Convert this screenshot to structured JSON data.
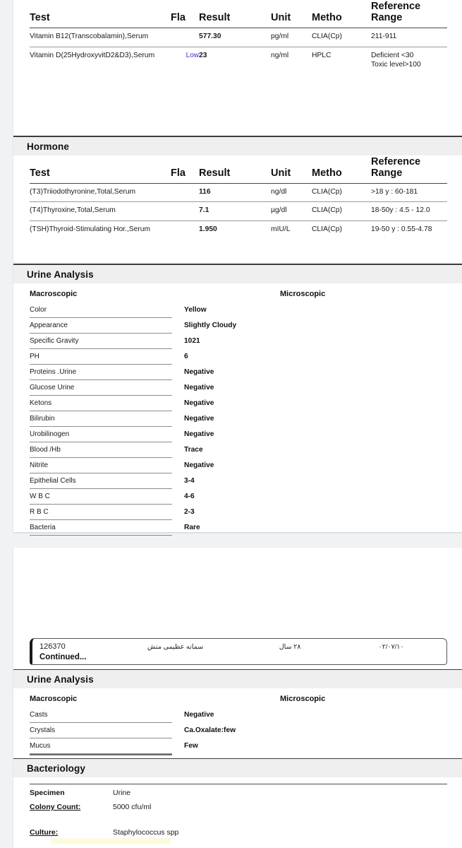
{
  "report": {
    "columns": {
      "test": "Test",
      "flag": "Fla",
      "result": "Result",
      "unit": "Unit",
      "method": "Metho",
      "reference": "Reference Range"
    },
    "vitamin_rows": [
      {
        "test": "Vitamin B12(Transcobalamin),Serum",
        "flag": "",
        "result": "577.30",
        "unit": "pg/ml",
        "method": "CLIA(Cp)",
        "reference": "211-911"
      },
      {
        "test": "Vitamin D(25HydroxyvitD2&D3),Serum",
        "flag": "Low",
        "result": "23",
        "unit": "ng/ml",
        "method": "HPLC",
        "reference": "Deficient <30\nToxic level>100"
      }
    ],
    "hormone": {
      "section_title": "Hormone",
      "rows": [
        {
          "test": "(T3)Triiodothyronine,Total,Serum",
          "flag": "",
          "result": "116",
          "unit": "ng/dl",
          "method": "CLIA(Cp)",
          "reference": ">18 y : 60-181"
        },
        {
          "test": "(T4)Thyroxine,Total,Serum",
          "flag": "",
          "result": "7.1",
          "unit": "µg/dl",
          "method": "CLIA(Cp)",
          "reference": "18-50y : 4.5 - 12.0"
        },
        {
          "test": "(TSH)Thyroid-Stimulating Hor.,Serum",
          "flag": "",
          "result": "1.950",
          "unit": "mIU/L",
          "method": "CLIA(Cp)",
          "reference": "19-50 y : 0.55-4.78"
        }
      ]
    },
    "urine_analysis_page1": {
      "section_title": "Urine Analysis",
      "macroscopic_label": "Macroscopic",
      "microscopic_label": "Microscopic",
      "rows": [
        {
          "label": "Color",
          "value": "Yellow"
        },
        {
          "label": "Appearance",
          "value": "Slightly Cloudy"
        },
        {
          "label": "Specific Gravity",
          "value": "1021"
        },
        {
          "label": "PH",
          "value": "6"
        },
        {
          "label": "Proteins .Urine",
          "value": "Negative"
        },
        {
          "label": "Glucose Urine",
          "value": "Negative"
        },
        {
          "label": "Ketons",
          "value": "Negative"
        },
        {
          "label": "Bilirubin",
          "value": "Negative"
        },
        {
          "label": "Urobilinogen",
          "value": "Negative"
        },
        {
          "label": "Blood /Hb",
          "value": "Trace"
        },
        {
          "label": "Nitrite",
          "value": "Negative"
        },
        {
          "label": "Epithelial Cells",
          "value": "3-4"
        },
        {
          "label": "W B C",
          "value": "4-6"
        },
        {
          "label": "R B C",
          "value": "2-3"
        },
        {
          "label": "Bacteria",
          "value": "Rare"
        }
      ]
    },
    "continued_banner": {
      "patient_id": "126370",
      "patient_name": "سمانه عظیمی منش",
      "patient_age": "۲۸ سال",
      "date": "۰۲/۰۷/۱۰",
      "label": "Continued..."
    },
    "urine_analysis_page2": {
      "section_title": "Urine Analysis",
      "macroscopic_label": "Macroscopic",
      "microscopic_label": "Microscopic",
      "rows": [
        {
          "label": "Casts",
          "value": "Negative"
        },
        {
          "label": "Crystals",
          "value": "Ca.Oxalate:few"
        },
        {
          "label": "Mucus",
          "value": "Few"
        }
      ]
    },
    "bacteriology": {
      "section_title": "Bacteriology",
      "rows": [
        {
          "key": "Specimen",
          "underline": false,
          "value": "Urine"
        },
        {
          "key": "Colony Count:",
          "underline": true,
          "value": "5000 cfu/ml"
        },
        {
          "key": "Culture:",
          "underline": true,
          "value": "Staphylococcus spp"
        }
      ]
    },
    "colors": {
      "flag_low": "#3333cc",
      "section_band": "#efefef",
      "page_background": "#f1f2f4",
      "sheet": "#ffffff"
    }
  }
}
